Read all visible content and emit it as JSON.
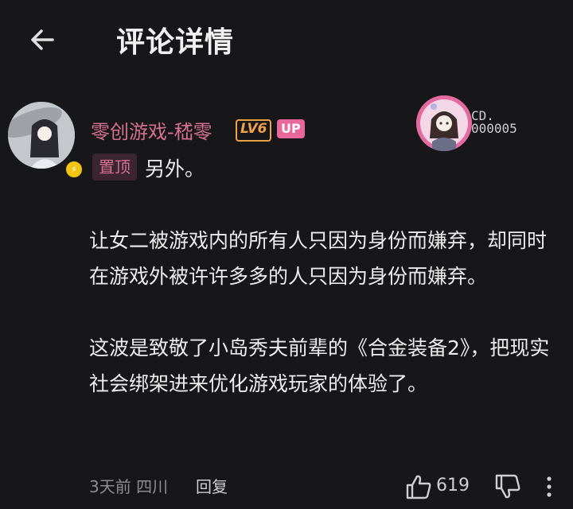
{
  "header": {
    "title": "评论详情"
  },
  "comment": {
    "user_name": "零创游戏-嵇零",
    "level": "LV6",
    "up_label": "UP",
    "fan_badge_label": "CD.\n000005",
    "pin_label": "置顶",
    "paragraphs": [
      "另外。",
      "让女二被游戏内的所有人只因为身份而嫌弃，却同时在游戏外被许许多多的人只因为身份而嫌弃。",
      "这波是致敬了小岛秀夫前辈的《合金装备2》，把现实社会绑架进来优化游戏玩家的体验了。"
    ],
    "meta": "3天前  四川",
    "reply_label": "回复",
    "like_count": "619"
  },
  "colors": {
    "accent": "#d6708f",
    "level": "#f0a14a",
    "up": "#e9679a",
    "bg": "#17171a"
  },
  "icons": [
    "back-arrow-icon",
    "like-icon",
    "dislike-icon",
    "more-icon"
  ]
}
